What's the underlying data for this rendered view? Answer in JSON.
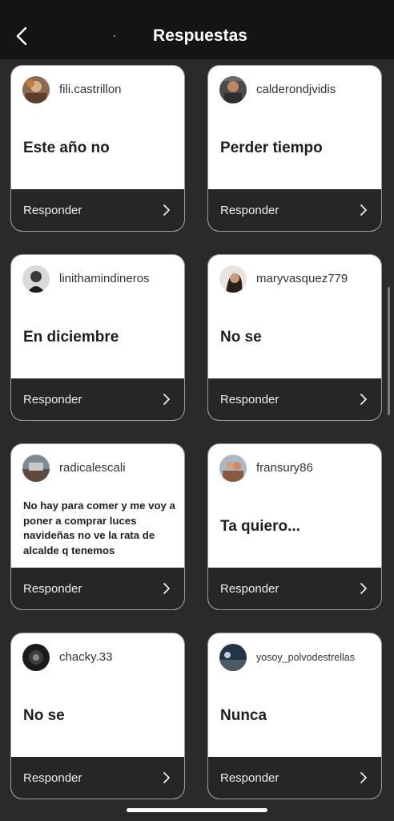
{
  "header": {
    "title": "Respuestas",
    "back_icon": "chevron-left-icon"
  },
  "reply_label": "Responder",
  "colors": {
    "header_bg": "#141414",
    "page_bg": "#2a2a2a",
    "card_bg": "#ffffff",
    "card_footer_bg": "#262626"
  },
  "cards": [
    {
      "username": "fili.castrillon",
      "answer": "Este año no",
      "reply": "Responder"
    },
    {
      "username": "calderondjvidis",
      "answer": "Perder tiempo",
      "reply": "Responder"
    },
    {
      "username": "linithamindineros",
      "answer": "En diciembre",
      "reply": "Responder"
    },
    {
      "username": "maryvasquez779",
      "answer": "No se",
      "reply": "Responder"
    },
    {
      "username": "radicalescali",
      "answer": "No hay para comer y me voy a poner a comprar luces navideñas no ve la rata de alcalde q tenemos",
      "reply": "Responder"
    },
    {
      "username": "fransury86",
      "answer": "Ta quiero...",
      "reply": "Responder"
    },
    {
      "username": "chacky.33",
      "answer": "No se",
      "reply": "Responder"
    },
    {
      "username": "yosoy_polvodestrellas",
      "answer": "Nunca",
      "reply": "Responder"
    }
  ]
}
